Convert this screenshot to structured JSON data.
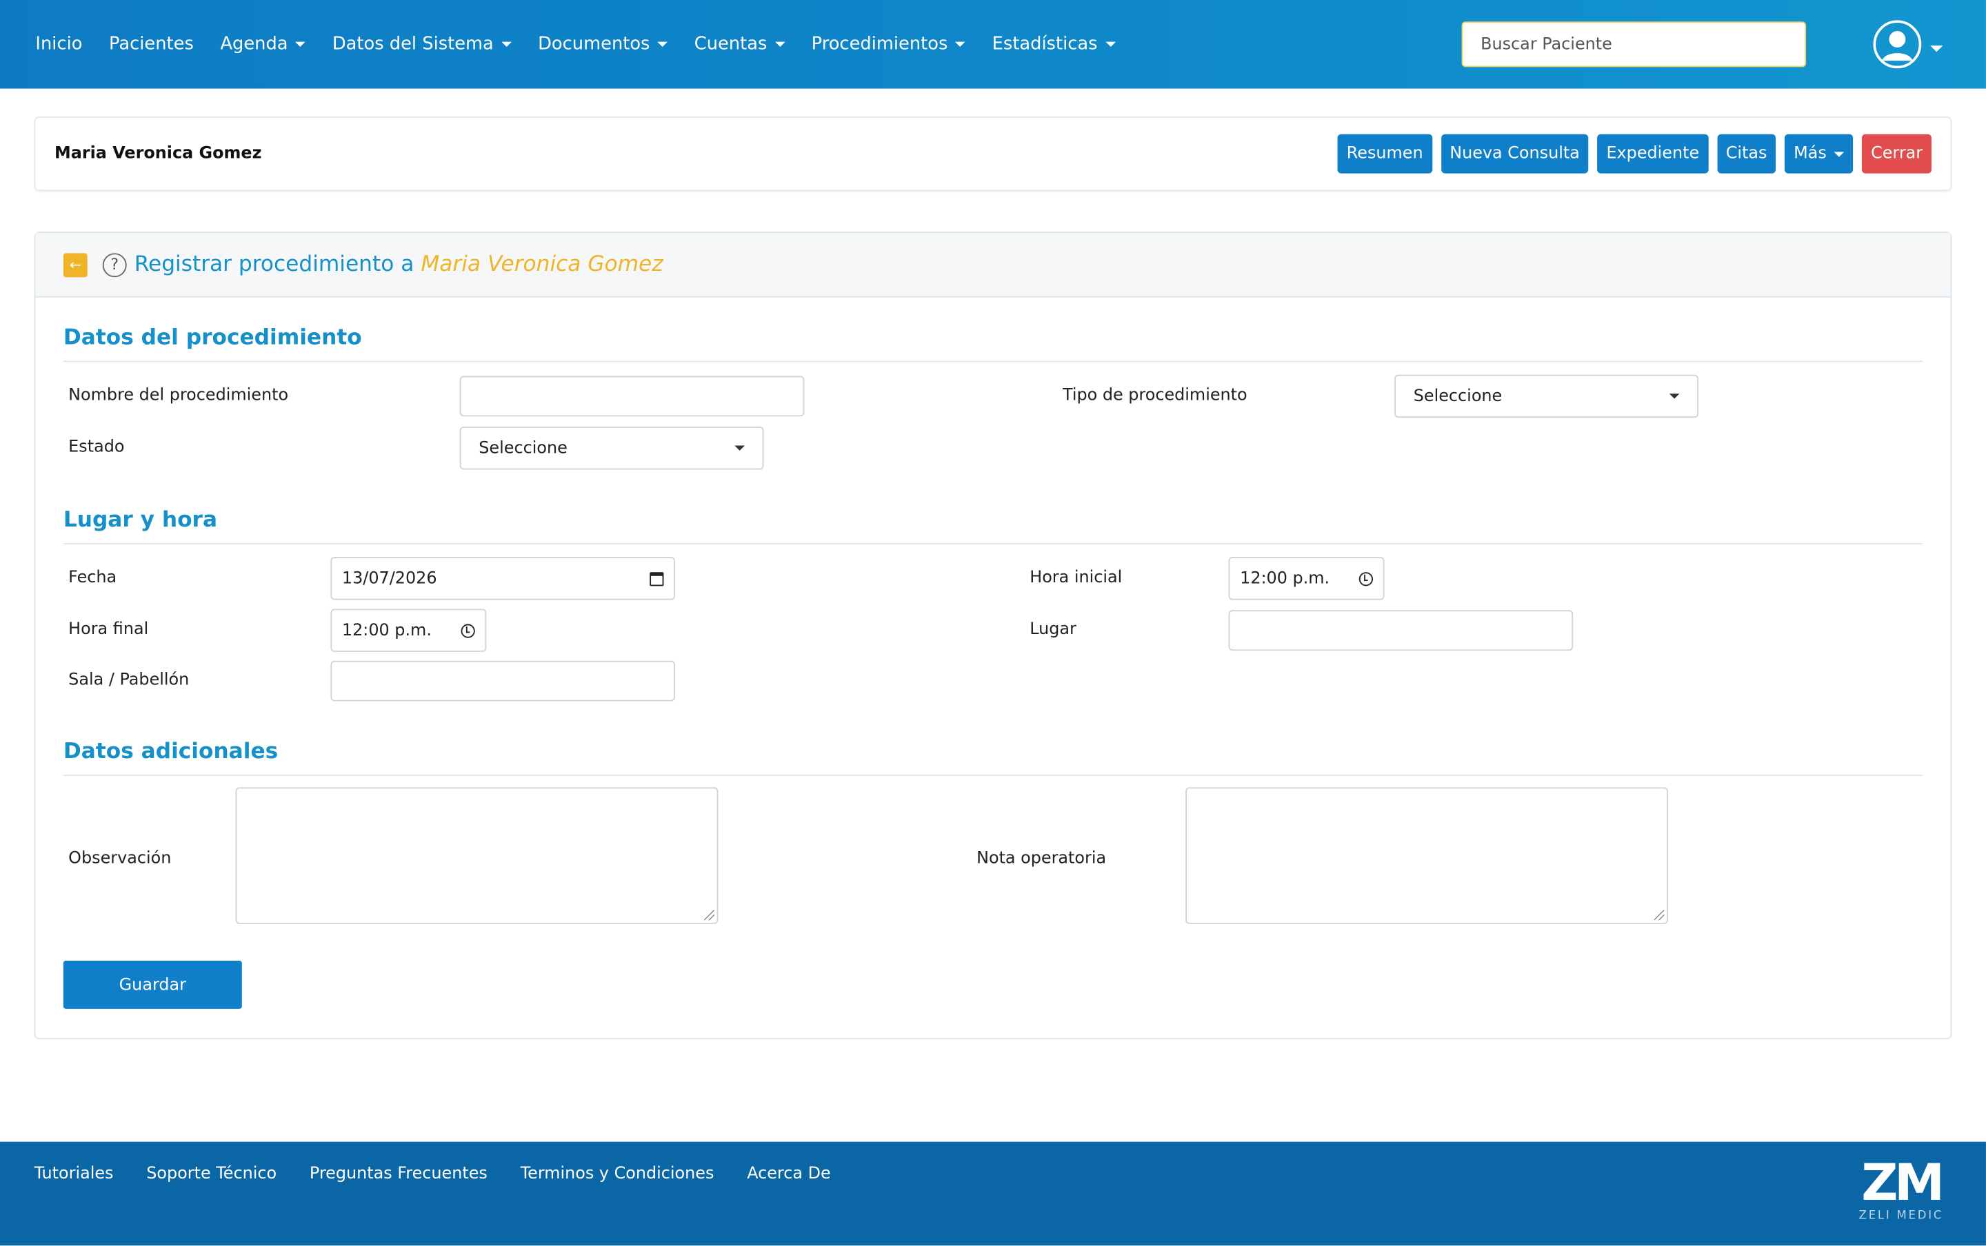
{
  "nav": {
    "items": [
      {
        "label": "Inicio",
        "dropdown": false
      },
      {
        "label": "Pacientes",
        "dropdown": false
      },
      {
        "label": "Agenda",
        "dropdown": true
      },
      {
        "label": "Datos del Sistema",
        "dropdown": true
      },
      {
        "label": "Documentos",
        "dropdown": true
      },
      {
        "label": "Cuentas",
        "dropdown": true
      },
      {
        "label": "Procedimientos",
        "dropdown": true
      },
      {
        "label": "Estadísticas",
        "dropdown": true
      }
    ],
    "search_placeholder": "Buscar Paciente"
  },
  "patient_bar": {
    "name": "Maria Veronica Gomez",
    "buttons": {
      "resumen": "Resumen",
      "nueva_consulta": "Nueva Consulta",
      "expediente": "Expediente",
      "citas": "Citas",
      "mas": "Más",
      "cerrar": "Cerrar"
    }
  },
  "panel": {
    "title_prefix": "Registrar procedimiento a",
    "patient_name": "Maria Veronica Gomez",
    "sections": {
      "datos": "Datos del procedimiento",
      "lugar": "Lugar y hora",
      "adicionales": "Datos adicionales"
    },
    "labels": {
      "nombre": "Nombre del procedimiento",
      "tipo": "Tipo de procedimiento",
      "estado": "Estado",
      "fecha": "Fecha",
      "hora_inicial": "Hora inicial",
      "hora_final": "Hora final",
      "lugar": "Lugar",
      "sala": "Sala / Pabellón",
      "observacion": "Observación",
      "nota": "Nota operatoria"
    },
    "values": {
      "nombre": "",
      "tipo": "Seleccione",
      "estado": "Seleccione",
      "fecha": "13/07/2026",
      "hora_inicial": "12:00 p.m.",
      "hora_final": "12:00 p.m.",
      "lugar": "",
      "sala": ""
    },
    "save_label": "Guardar"
  },
  "footer": {
    "links": [
      "Tutoriales",
      "Soporte Técnico",
      "Preguntas Frecuentes",
      "Terminos y Condiciones",
      "Acerca De"
    ],
    "logo_mark": "ZM",
    "logo_text": "ZELI MEDIC"
  },
  "colors": {
    "primary": "#0f7fc9",
    "accent": "#f0b429",
    "danger": "#e14c4c",
    "heading": "#1590c9",
    "footer": "#0b66a6"
  }
}
